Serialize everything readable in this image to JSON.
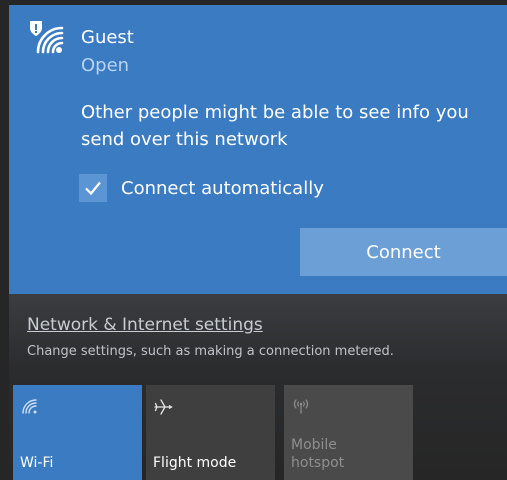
{
  "network": {
    "name": "Guest",
    "status": "Open",
    "warning": "Other people might be able to see info you send over this network",
    "auto_connect_label": "Connect automatically",
    "auto_connect_checked": true,
    "connect_label": "Connect",
    "icon": "wifi-secured-warning-icon"
  },
  "settings": {
    "link_label": "Network & Internet settings",
    "description": "Change settings, such as making a connection metered."
  },
  "quick_actions": [
    {
      "label": "Wi-Fi",
      "icon": "wifi-icon",
      "active": true
    },
    {
      "label": "Flight mode",
      "icon": "airplane-icon",
      "active": false
    },
    {
      "label": "Mobile hotspot",
      "icon": "hotspot-icon",
      "active": false,
      "disabled": true
    }
  ],
  "colors": {
    "accent": "#3a7bc2",
    "connect_button": "#6c9fd6",
    "background_dark": "#262626"
  }
}
